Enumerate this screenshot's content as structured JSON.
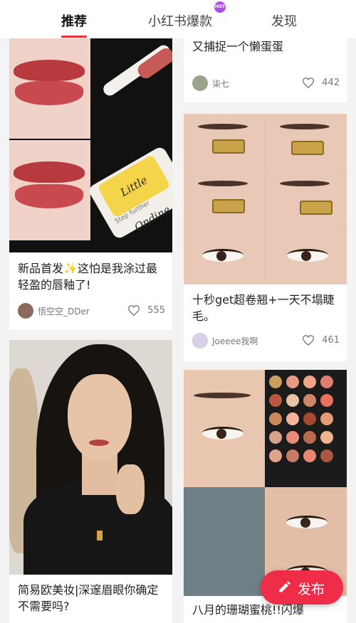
{
  "tabs": [
    {
      "label": "推荐",
      "active": true
    },
    {
      "label": "小红书爆款",
      "badge": "HOT"
    },
    {
      "label": "发现"
    }
  ],
  "feed": {
    "left": [
      {
        "title": "新品首发✨这怕是我涂过最轻盈的唇釉了!",
        "author": "悟空空_DDer",
        "likes": "555",
        "image_text": "Little Ondine",
        "image_subtext": "Step further"
      },
      {
        "title": "简易欧美妆|深邃眉眼你确定不需要吗?"
      }
    ],
    "right": [
      {
        "title": "又捕捉一个懒蛋蛋",
        "author": "柒七",
        "likes": "442"
      },
      {
        "title": "十秒get超卷翘+一天不塌睫毛。",
        "author": "Joeeee我啊",
        "likes": "461"
      },
      {
        "title": "八月的珊瑚蜜桃!!闪爆"
      }
    ]
  },
  "publish_button": {
    "label": "发布"
  },
  "colors": {
    "accent": "#e8323c",
    "publish": "#ef2d48",
    "hot_badge": "#b04ee8"
  }
}
